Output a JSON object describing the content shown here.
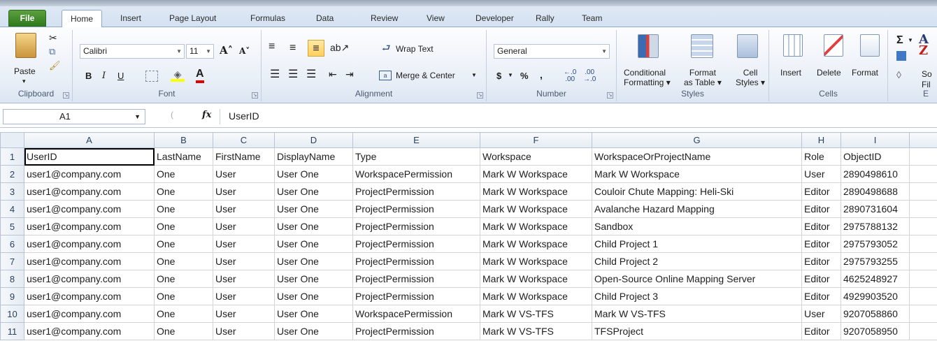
{
  "tabs": [
    "File",
    "Home",
    "Insert",
    "Page Layout",
    "Formulas",
    "Data",
    "Review",
    "View",
    "Developer",
    "Rally",
    "Team"
  ],
  "ribbon": {
    "clipboard": {
      "label": "Clipboard",
      "paste": "Paste"
    },
    "font": {
      "label": "Font",
      "name": "Calibri",
      "size": "11",
      "bold": "B",
      "italic": "I",
      "underline": "U"
    },
    "alignment": {
      "label": "Alignment",
      "wrap": "Wrap Text",
      "merge": "Merge & Center"
    },
    "number": {
      "label": "Number",
      "format": "General",
      "currency": "$",
      "percent": "%",
      "comma": ","
    },
    "styles": {
      "label": "Styles",
      "conditional1": "Conditional",
      "conditional2": "Formatting",
      "format_table1": "Format",
      "format_table2": "as Table",
      "cell_styles1": "Cell",
      "cell_styles2": "Styles"
    },
    "cells": {
      "label": "Cells",
      "insert": "Insert",
      "delete": "Delete",
      "format": "Format"
    },
    "editing": {
      "label": "E",
      "sort": "So",
      "filter": "Fil",
      "sigma": "Σ"
    }
  },
  "formula_bar": {
    "name_box": "A1",
    "fx": "fx",
    "value": "UserID"
  },
  "columns": [
    "A",
    "B",
    "C",
    "D",
    "E",
    "F",
    "G",
    "H",
    "I"
  ],
  "rows": [
    [
      "1",
      "UserID",
      "LastName",
      "FirstName",
      "DisplayName",
      "Type",
      "Workspace",
      "WorkspaceOrProjectName",
      "Role",
      "ObjectID"
    ],
    [
      "2",
      "user1@company.com",
      "One",
      "User",
      "User One",
      "WorkspacePermission",
      "Mark W Workspace",
      "Mark W Workspace",
      "User",
      "2890498610"
    ],
    [
      "3",
      "user1@company.com",
      "One",
      "User",
      "User One",
      "ProjectPermission",
      "Mark W Workspace",
      "Couloir Chute Mapping: Heli-Ski",
      "Editor",
      "2890498688"
    ],
    [
      "4",
      "user1@company.com",
      "One",
      "User",
      "User One",
      "ProjectPermission",
      "Mark W Workspace",
      "Avalanche Hazard Mapping",
      "Editor",
      "2890731604"
    ],
    [
      "5",
      "user1@company.com",
      "One",
      "User",
      "User One",
      "ProjectPermission",
      "Mark W Workspace",
      "Sandbox",
      "Editor",
      "2975788132"
    ],
    [
      "6",
      "user1@company.com",
      "One",
      "User",
      "User One",
      "ProjectPermission",
      "Mark W Workspace",
      "Child Project 1",
      "Editor",
      "2975793052"
    ],
    [
      "7",
      "user1@company.com",
      "One",
      "User",
      "User One",
      "ProjectPermission",
      "Mark W Workspace",
      "Child Project 2",
      "Editor",
      "2975793255"
    ],
    [
      "8",
      "user1@company.com",
      "One",
      "User",
      "User One",
      "ProjectPermission",
      "Mark W Workspace",
      "Open-Source Online Mapping Server",
      "Editor",
      "4625248927"
    ],
    [
      "9",
      "user1@company.com",
      "One",
      "User",
      "User One",
      "ProjectPermission",
      "Mark W Workspace",
      "Child Project 3",
      "Editor",
      "4929903520"
    ],
    [
      "10",
      "user1@company.com",
      "One",
      "User",
      "User One",
      "WorkspacePermission",
      "Mark W VS-TFS",
      "Mark W VS-TFS",
      "User",
      "9207058860"
    ],
    [
      "11",
      "user1@company.com",
      "One",
      "User",
      "User One",
      "ProjectPermission",
      "Mark W VS-TFS",
      "TFSProject",
      "Editor",
      "9207058950"
    ]
  ]
}
